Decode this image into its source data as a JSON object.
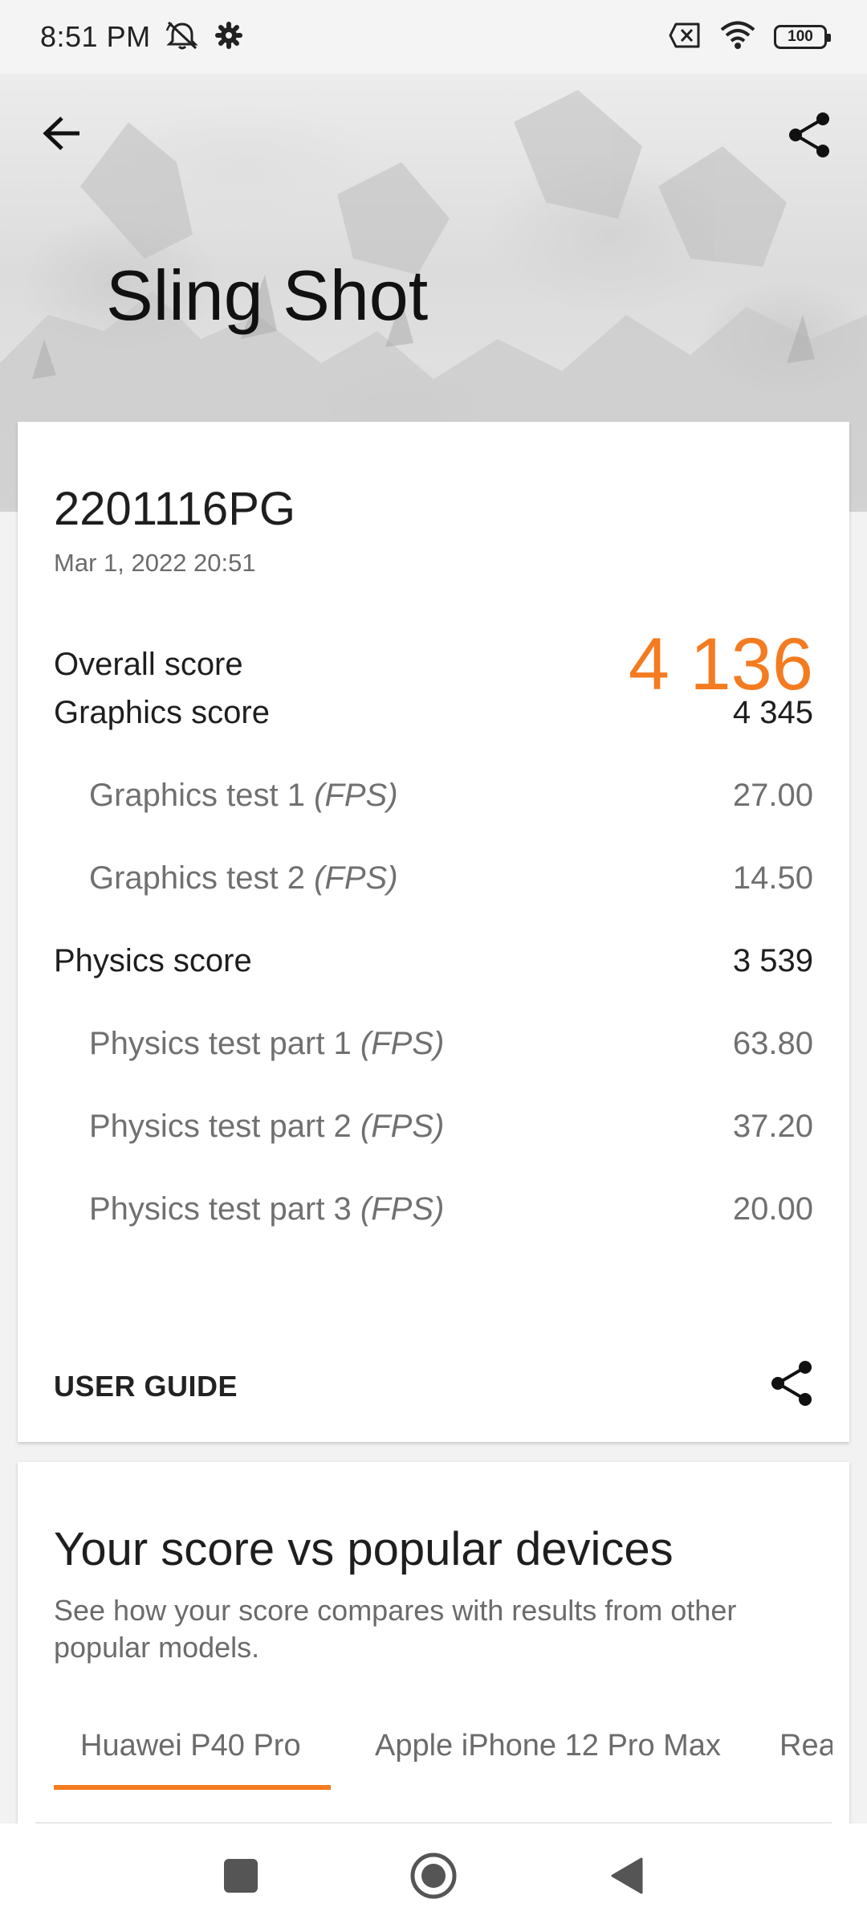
{
  "status_bar": {
    "time": "8:51 PM",
    "battery": "100",
    "icons": [
      "alarm-off-icon",
      "settings-icon",
      "no-sim-icon",
      "wifi-icon",
      "battery-icon"
    ]
  },
  "header": {
    "title": "Sling Shot",
    "back_icon": "arrow-left-icon",
    "share_icon": "share-icon"
  },
  "results": {
    "device": "2201116PG",
    "date": "Mar 1, 2022 20:51",
    "overall_label": "Overall score",
    "overall_value": "4 136",
    "rows": [
      {
        "label": "Graphics score",
        "suffix": "",
        "value": "4 345",
        "sub": false
      },
      {
        "label": "Graphics test 1 ",
        "suffix": "(FPS)",
        "value": "27.00",
        "sub": true
      },
      {
        "label": "Graphics test 2 ",
        "suffix": "(FPS)",
        "value": "14.50",
        "sub": true
      },
      {
        "label": "Physics score",
        "suffix": "",
        "value": "3 539",
        "sub": false
      },
      {
        "label": "Physics test part 1 ",
        "suffix": "(FPS)",
        "value": "63.80",
        "sub": true
      },
      {
        "label": "Physics test part 2 ",
        "suffix": "(FPS)",
        "value": "37.20",
        "sub": true
      },
      {
        "label": "Physics test part 3 ",
        "suffix": "(FPS)",
        "value": "20.00",
        "sub": true
      }
    ],
    "user_guide": "USER GUIDE"
  },
  "compare": {
    "title": "Your score vs popular devices",
    "description": "See how your score compares with results from other popular models.",
    "tabs": [
      "Huawei P40 Pro",
      "Apple iPhone 12 Pro Max",
      "Rea"
    ],
    "active_tab": 0
  },
  "colors": {
    "accent": "#f47b20",
    "text_primary": "#1e1e1e",
    "text_secondary": "#707070"
  },
  "nav": {
    "recents_icon": "square-icon",
    "home_icon": "circle-icon",
    "back_icon": "triangle-back-icon"
  }
}
